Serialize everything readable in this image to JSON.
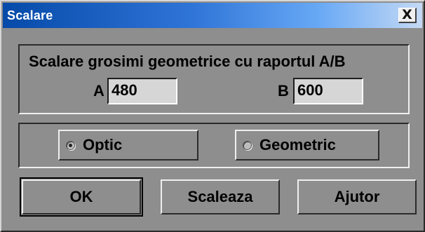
{
  "dialog": {
    "title": "Scalare",
    "close_icon": "close-icon",
    "close_label": "X"
  },
  "scale_group": {
    "heading": "Scalare grosimi geometrice cu raportul A/B",
    "field_a_label": "A",
    "field_a_value": "480",
    "field_b_label": "B",
    "field_b_value": "600"
  },
  "mode_group": {
    "options": [
      {
        "label": "Optic",
        "selected": true,
        "icon": "radio-selected-icon"
      },
      {
        "label": "Geometric",
        "selected": false,
        "icon": "radio-unselected-icon"
      }
    ]
  },
  "buttons": {
    "ok_label": "OK",
    "scale_label": "Scaleaza",
    "help_label": "Ajutor"
  },
  "colors": {
    "dialog_face": "#8e8e8e",
    "titlebar_start": "#064aa9",
    "titlebar_end": "#c4d9f4",
    "textbox_face": "#d6d6d6"
  }
}
